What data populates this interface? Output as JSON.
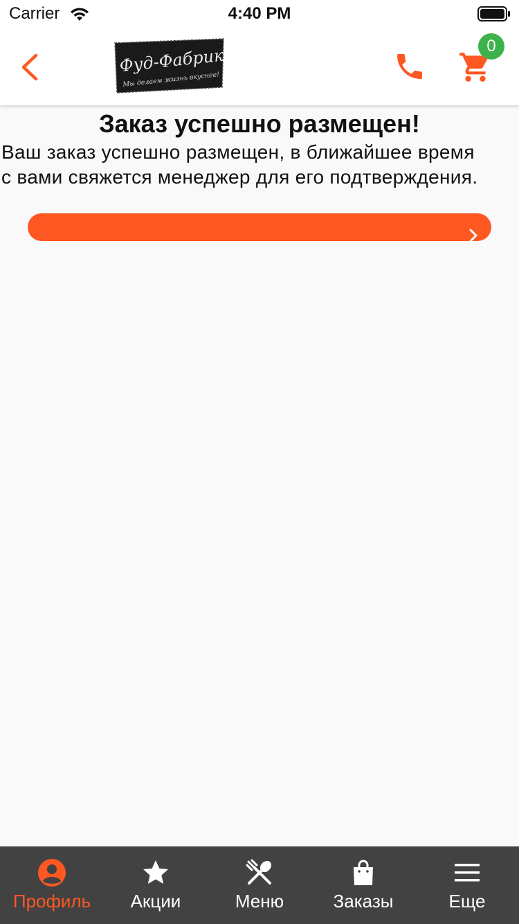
{
  "status_bar": {
    "carrier": "Carrier",
    "time": "4:40 PM"
  },
  "nav": {
    "logo_text": "Фуд-Фабрик",
    "logo_tagline": "Мы делаем жизнь вкуснее!",
    "cart_count": "0"
  },
  "main": {
    "title": "Заказ успешно размещен!",
    "message": "Ваш заказ успешно размещен, в ближайшее время с вами свяжется менеджер для его подтверждения."
  },
  "tabs": [
    {
      "label": "Профиль",
      "icon": "profile-icon",
      "active": true
    },
    {
      "label": "Акции",
      "icon": "star-icon",
      "active": false
    },
    {
      "label": "Меню",
      "icon": "utensils-icon",
      "active": false
    },
    {
      "label": "Заказы",
      "icon": "shopping-bag-icon",
      "active": false
    },
    {
      "label": "Еще",
      "icon": "menu-icon",
      "active": false
    }
  ],
  "colors": {
    "accent": "#ff5722",
    "badge": "#3db24a",
    "tab_bar": "#424242"
  }
}
